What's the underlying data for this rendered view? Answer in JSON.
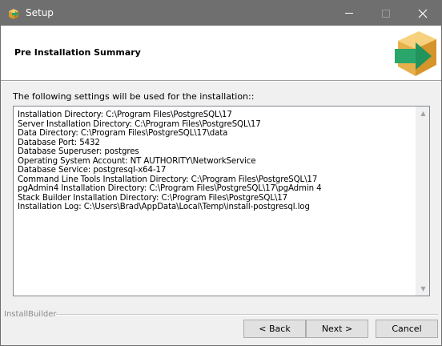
{
  "window": {
    "title": "Setup",
    "icons": {
      "app": "setup-box-icon",
      "minimize": "minimize-icon",
      "maximize": "maximize-icon",
      "close": "close-icon"
    }
  },
  "header": {
    "title": "Pre Installation Summary",
    "logo_icon": "installer-box-arrow-icon"
  },
  "body": {
    "intro": "The following settings will be used for the installation::",
    "summary_lines": [
      "Installation Directory: C:\\Program Files\\PostgreSQL\\17",
      "Server Installation Directory: C:\\Program Files\\PostgreSQL\\17",
      "Data Directory: C:\\Program Files\\PostgreSQL\\17\\data",
      "Database Port: 5432",
      "Database Superuser: postgres",
      "Operating System Account: NT AUTHORITY\\NetworkService",
      "Database Service: postgresql-x64-17",
      "Command Line Tools Installation Directory: C:\\Program Files\\PostgreSQL\\17",
      "pgAdmin4 Installation Directory: C:\\Program Files\\PostgreSQL\\17\\pgAdmin 4",
      "Stack Builder Installation Directory: C:\\Program Files\\PostgreSQL\\17",
      "Installation Log: C:\\Users\\Brad\\AppData\\Local\\Temp\\install-postgresql.log"
    ]
  },
  "footer": {
    "brand": "InstallBuilder",
    "back_label": "< Back",
    "next_label": "Next >",
    "cancel_label": "Cancel"
  },
  "colors": {
    "titlebar": "#6f6f6f",
    "logo_box": "#e8b04a",
    "logo_arrow": "#2aa66b"
  }
}
